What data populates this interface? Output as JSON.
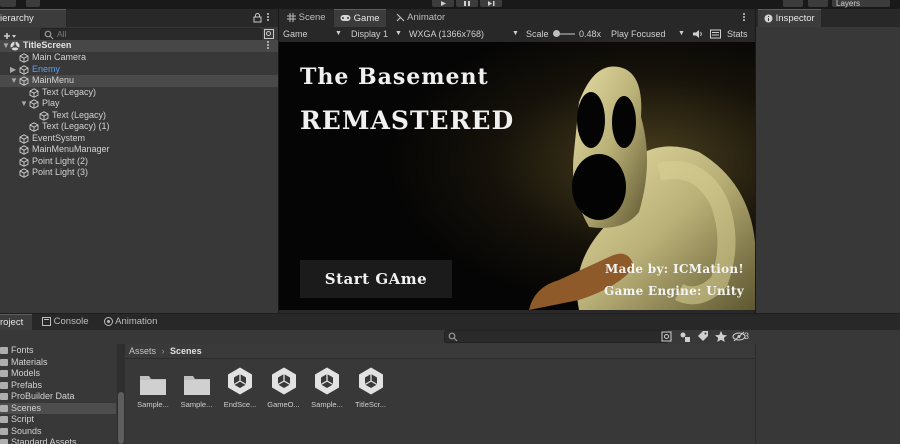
{
  "hierarchy": {
    "tab_label": "ierarchy",
    "search_placeholder": "All",
    "scene_name": "TitleScreen",
    "items": [
      {
        "label": "Main Camera",
        "depth": 1,
        "expander": ""
      },
      {
        "label": "Enemy",
        "depth": 1,
        "expander": "▶",
        "color": "#5aa0f0"
      },
      {
        "label": "MainMenu",
        "depth": 1,
        "expander": "▼"
      },
      {
        "label": "Text (Legacy)",
        "depth": 2,
        "expander": ""
      },
      {
        "label": "Play",
        "depth": 2,
        "expander": "▼"
      },
      {
        "label": "Text (Legacy)",
        "depth": 3,
        "expander": ""
      },
      {
        "label": "Text (Legacy) (1)",
        "depth": 2,
        "expander": ""
      },
      {
        "label": "EventSystem",
        "depth": 1,
        "expander": ""
      },
      {
        "label": "MainMenuManager",
        "depth": 1,
        "expander": ""
      },
      {
        "label": "Point Light (2)",
        "depth": 1,
        "expander": ""
      },
      {
        "label": "Point Light (3)",
        "depth": 1,
        "expander": ""
      }
    ]
  },
  "game_view": {
    "tabs": [
      "Scene",
      "Game",
      "Animator"
    ],
    "mode": "Game",
    "display": "Display 1",
    "resolution": "WXGA (1366x768)",
    "scale_label": "Scale",
    "scale_value": "0.48x",
    "play_focused": "Play Focused",
    "stats": "Stats",
    "screen": {
      "title_line1": "The Basement",
      "title_line2": "REMASTERED",
      "start_button": "Start GAme",
      "credit_line1": "Made by: ICMation!",
      "credit_line2": "Game Engine: Unity"
    }
  },
  "inspector": {
    "tab_label": "Inspector"
  },
  "toolbar": {
    "layers_label": "Layers"
  },
  "project": {
    "tabs": [
      "roject",
      "Console",
      "Animation"
    ],
    "breadcrumb": [
      "Assets",
      "Scenes"
    ],
    "hidden_count": "3",
    "folders": [
      "Fonts",
      "Materials",
      "Models",
      "Prefabs",
      "ProBuilder Data",
      "Scenes",
      "Script",
      "Sounds",
      "Standard Assets"
    ],
    "selected_folder": "Scenes",
    "assets": [
      {
        "name": "Sample...",
        "kind": "folder"
      },
      {
        "name": "Sample...",
        "kind": "folder"
      },
      {
        "name": "EndSce...",
        "kind": "scene"
      },
      {
        "name": "GameO...",
        "kind": "scene"
      },
      {
        "name": "Sample...",
        "kind": "scene"
      },
      {
        "name": "TitleScr...",
        "kind": "scene"
      }
    ]
  },
  "colors": {
    "panel": "#383838",
    "tabbar": "#282828",
    "selection": "#4a4a4a",
    "link_blue": "#5aa0f0",
    "monster": "#c9c48d"
  }
}
